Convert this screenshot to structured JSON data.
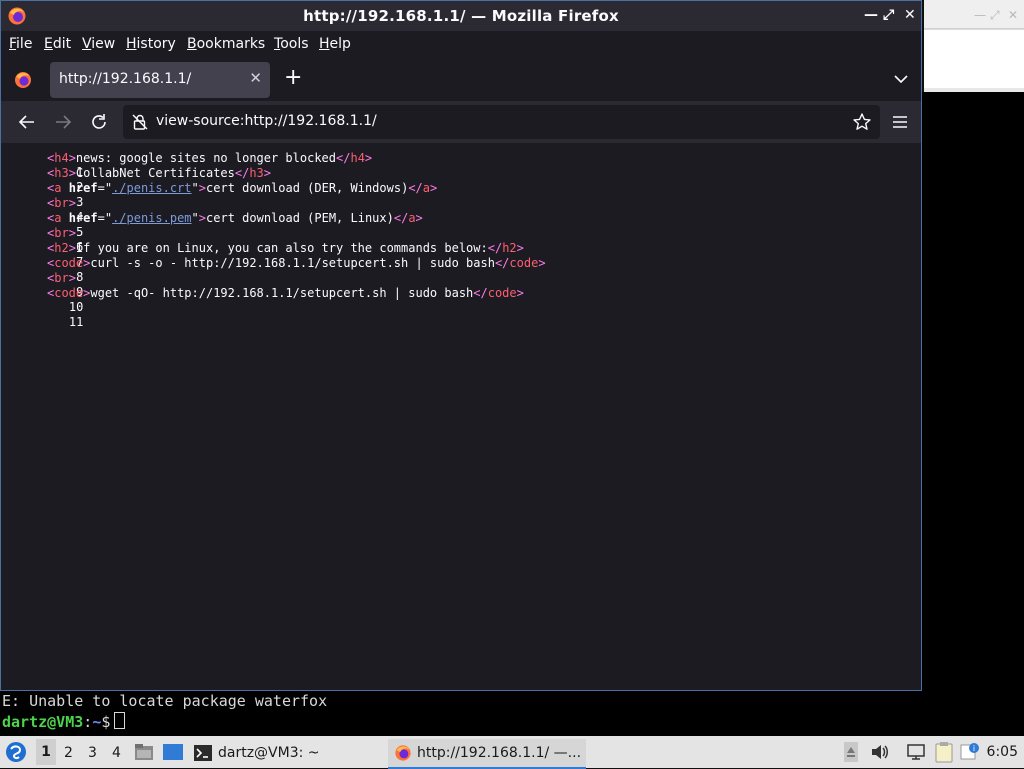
{
  "window": {
    "title": "http://192.168.1.1/ — Mozilla Firefox"
  },
  "menubar": [
    "File",
    "Edit",
    "View",
    "History",
    "Bookmarks",
    "Tools",
    "Help"
  ],
  "tab": {
    "label": "http://192.168.1.1/"
  },
  "urlbar": {
    "value": "view-source:http://192.168.1.1/"
  },
  "source": {
    "line_numbers": [
      "1",
      "2",
      "3",
      "4",
      "5",
      "6",
      "7",
      "8",
      "9",
      "10",
      "11"
    ],
    "l1": {
      "open": "h4",
      "text": "news: google sites no longer blocked",
      "close": "h4"
    },
    "l2": {
      "open": "h3",
      "text": "CollabNet Certificates",
      "close": "h3"
    },
    "l3": {
      "tag": "a",
      "attr": "href",
      "href": "./penis.crt",
      "text": "cert download (DER, Windows)",
      "close": "a"
    },
    "l4": {
      "tag": "br"
    },
    "l5": {
      "tag": "a",
      "attr": "href",
      "href": "./penis.pem",
      "text": "cert download (PEM, Linux)",
      "close": "a"
    },
    "l6": {
      "tag": "br"
    },
    "l7": {
      "open": "h2",
      "text": "If you are on Linux, you can also try the commands below:",
      "close": "h2"
    },
    "l8": {
      "open": "code",
      "text": "curl -s -o - http://192.168.1.1/setupcert.sh | sudo bash",
      "close": "code"
    },
    "l9": {
      "tag": "br"
    },
    "l10": {
      "open": "code",
      "text": "wget -qO- http://192.168.1.1/setupcert.sh | sudo bash",
      "close": "code"
    }
  },
  "terminal": {
    "error_line": "E: Unable to locate package waterfox",
    "prompt_user": "dartz@VM3",
    "prompt_sep": ":",
    "prompt_path": "~",
    "prompt_symbol": "$"
  },
  "taskbar": {
    "workspaces": [
      "1",
      "2",
      "3",
      "4"
    ],
    "terminal_task": "dartz@VM3: ~",
    "firefox_task": "http://192.168.1.1/ —...",
    "clock": "6:05"
  }
}
